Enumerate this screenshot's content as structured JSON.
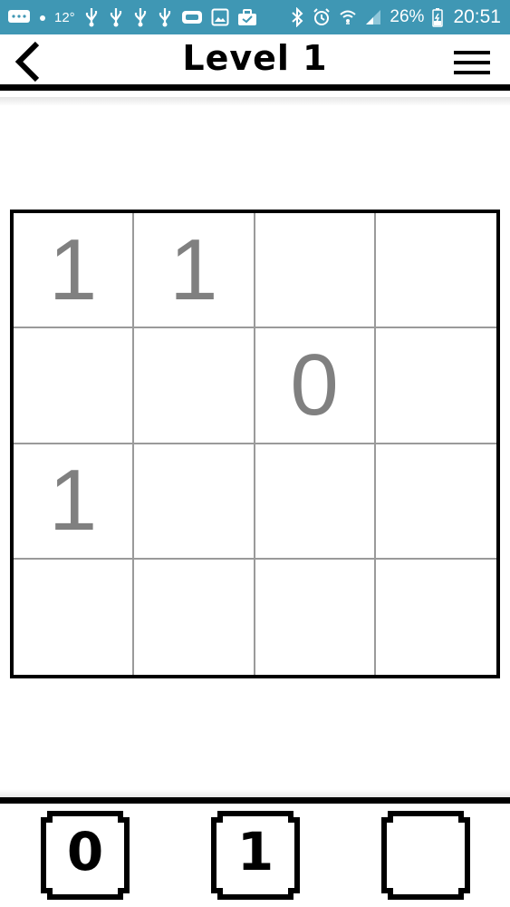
{
  "status_bar": {
    "temperature": "12°",
    "battery_percent": "26%",
    "time": "20:51",
    "left_icons": [
      "message-icon",
      "dot-icon",
      "temperature-text",
      "usb-icon",
      "usb-icon",
      "usb-icon",
      "usb-icon",
      "vr-icon",
      "image-icon",
      "briefcase-icon"
    ],
    "right_icons": [
      "bluetooth-icon",
      "alarm-icon",
      "wifi-icon",
      "signal-icon",
      "battery-icon"
    ],
    "background_color": "#3f97b4"
  },
  "header": {
    "back_icon": "chevron-left-icon",
    "title": "Level 1",
    "menu_icon": "hamburger-menu-icon"
  },
  "board": {
    "rows": 4,
    "cols": 4,
    "cells": [
      [
        "1",
        "1",
        "",
        ""
      ],
      [
        "",
        "",
        "0",
        ""
      ],
      [
        "1",
        "",
        "",
        ""
      ],
      [
        "",
        "",
        "",
        ""
      ]
    ],
    "given_digit_color": "#808080"
  },
  "choices": [
    {
      "label": "0"
    },
    {
      "label": "1"
    },
    {
      "label": ""
    }
  ]
}
